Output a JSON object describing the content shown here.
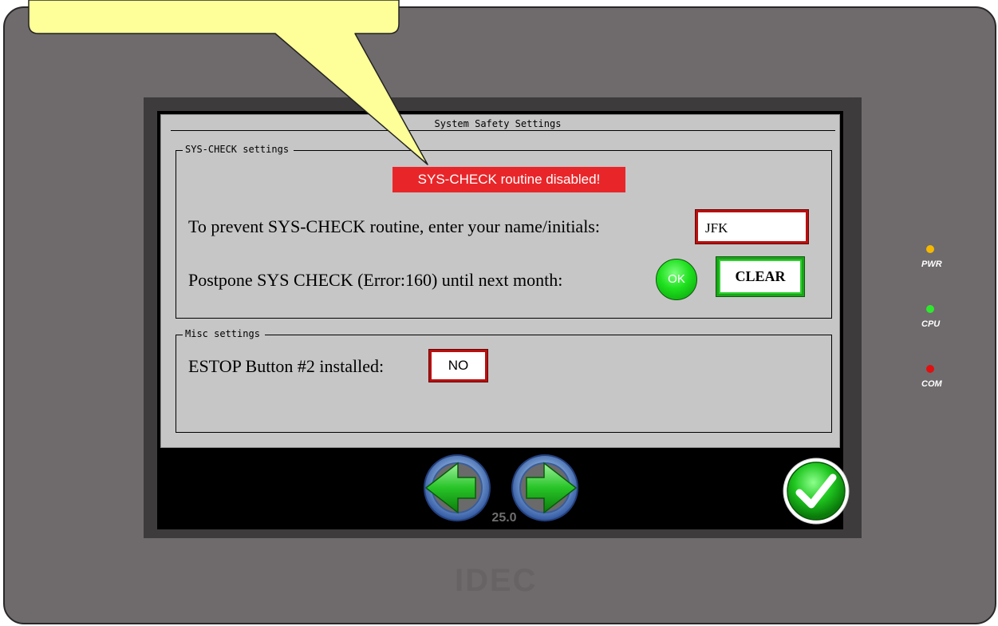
{
  "screen_title": "System Safety Settings",
  "syscheck_group": {
    "legend": "SYS-CHECK settings",
    "alarm_text": "SYS-CHECK routine disabled!",
    "name_prompt": "To prevent SYS-CHECK routine, enter your name/initials:",
    "name_value": "JFK",
    "postpone_prompt": "Postpone SYS CHECK (Error:160) until next month:",
    "ok_label": "OK",
    "clear_label": "CLEAR"
  },
  "misc_group": {
    "legend": "Misc settings",
    "estop_prompt": "ESTOP Button #2 installed:",
    "estop_value": "NO"
  },
  "navigation": {
    "page_number": "25.0",
    "prev_icon": "left-arrow-icon",
    "next_icon": "right-arrow-icon",
    "confirm_icon": "checkmark-icon"
  },
  "indicators": [
    {
      "label": "PWR",
      "color": "#f5b800"
    },
    {
      "label": "CPU",
      "color": "#2ee82e"
    },
    {
      "label": "COM",
      "color": "#e01010"
    }
  ],
  "bezel_brand": "IDEC",
  "colors": {
    "bezel": "#6f6b6c",
    "panel": "#c7c6c6",
    "alarm": "#e8262a",
    "callout": "#ffff99"
  }
}
